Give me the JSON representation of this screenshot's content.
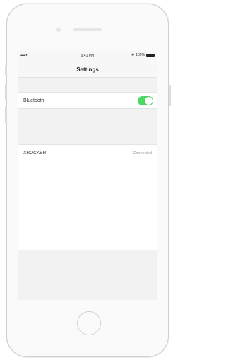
{
  "status_bar": {
    "signal": "••••• ᵜ",
    "time": "9:41 PM",
    "battery_text": "100%"
  },
  "nav": {
    "title": "Settings"
  },
  "bluetooth": {
    "label": "Bluetooth",
    "enabled": true,
    "toggle_color": "#4cd964"
  },
  "devices": [
    {
      "name": "XROCKER",
      "status": "Connected"
    }
  ]
}
